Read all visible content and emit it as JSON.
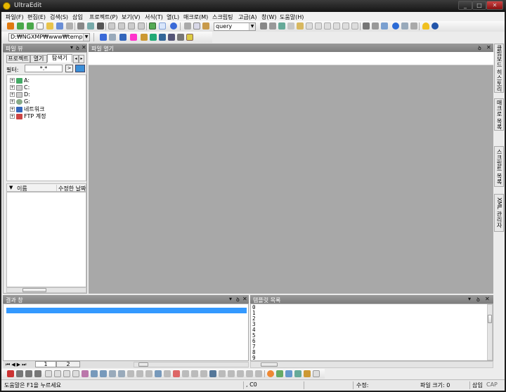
{
  "window": {
    "title": "UltraEdit",
    "controls": [
      "_",
      "□",
      "✕"
    ]
  },
  "menu": [
    "파일(F)",
    "편집(E)",
    "검색(S)",
    "삽입",
    "프로젝트(P)",
    "보기(V)",
    "서식(T)",
    "열(L)",
    "매크로(M)",
    "스크립팅",
    "고급(A)",
    "창(W)",
    "도움말(H)"
  ],
  "toolbar": {
    "search_combo": "query"
  },
  "pathbar": {
    "path": "D:₩NGXMP₩www₩template₩C("
  },
  "fileview": {
    "title": "파일 뷰",
    "tabs": [
      "프로젝트",
      "열기",
      "탐색기"
    ],
    "filter_label": "필터:",
    "filter_value": "*.*",
    "drives": [
      "A:",
      "C:",
      "D:",
      "G:",
      "네트워크",
      "FTP 계정"
    ],
    "col_name": "이름",
    "col_modified": "수정한 날짜"
  },
  "open_files": {
    "title": "파일 열기"
  },
  "side_tabs": [
    "클립보드 히스토리",
    "매크로 목록",
    "스크립트 목록",
    "XML 관리자"
  ],
  "output": {
    "title": "결과 창",
    "tabs": [
      "1",
      "2"
    ]
  },
  "template_list": {
    "title": "템플릿 목록",
    "lines": [
      "0",
      "1",
      "2",
      "3",
      "4",
      "5",
      "6",
      "7",
      "8",
      "9"
    ]
  },
  "status": {
    "help": "도움말은 F1을 누르세요",
    "col": ", C0",
    "modified": "수정:",
    "filesize": "파일 크기: 0",
    "insert": "삽입",
    "cap": "CAP"
  }
}
